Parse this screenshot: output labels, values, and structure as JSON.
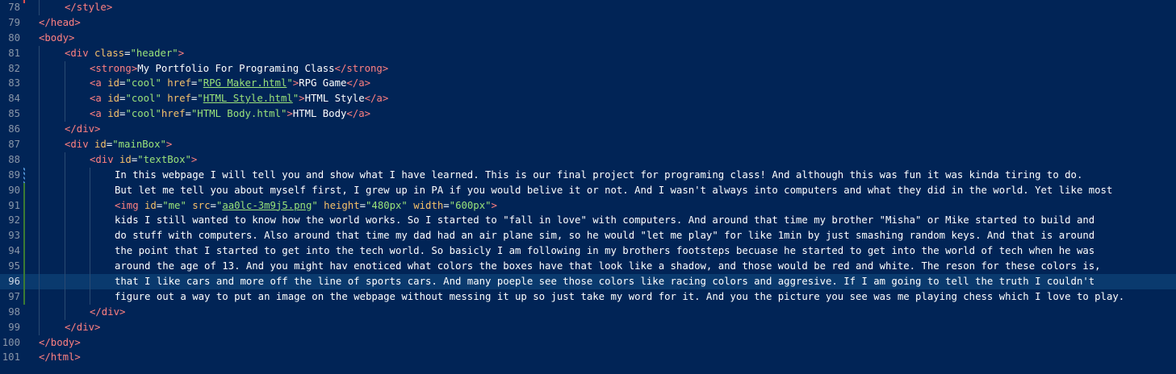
{
  "editor": {
    "line_numbers": [
      "78",
      "79",
      "80",
      "81",
      "82",
      "83",
      "84",
      "85",
      "86",
      "87",
      "88",
      "89",
      "90",
      "91",
      "92",
      "93",
      "94",
      "95",
      "96",
      "97",
      "98",
      "99",
      "100",
      "101"
    ],
    "l78": {
      "close_style": "</style>"
    },
    "l79": {
      "close_head": "</head>"
    },
    "l80": {
      "open_body": "<body>"
    },
    "l81": {
      "open": "<div ",
      "attr": "class",
      "eq": "=",
      "val": "\"header\"",
      "close": ">"
    },
    "l82": {
      "open": "<strong>",
      "text": "My Portfolio For Programing Class",
      "close": "</strong>"
    },
    "l83": {
      "open": "<a ",
      "attr1": "id",
      "eq1": "=",
      "val1": "\"cool\"",
      "attr2": " href",
      "eq2": "=",
      "q1": "\"",
      "href": "RPG Maker.html",
      "q2": "\"",
      "gt": ">",
      "text": "RPG Game",
      "close": "</a>"
    },
    "l84": {
      "open": "<a ",
      "attr1": "id",
      "eq1": "=",
      "val1": "\"cool\"",
      "attr2": " href",
      "eq2": "=",
      "q1": "\"",
      "href": "HTML Style.html",
      "q2": "\"",
      "gt": ">",
      "text": "HTML Style",
      "close": "</a>"
    },
    "l85": {
      "open": "<a ",
      "attr1": "id",
      "eq1": "=",
      "val1": "\"cool\"",
      "attr2": "href",
      "eq2": "=",
      "val2": "\"HTML Body.html\"",
      "gt": ">",
      "text": "HTML Body",
      "close": "</a>"
    },
    "l86": {
      "close_div": "</div>"
    },
    "l87": {
      "open": "<div ",
      "attr": "id",
      "eq": "=",
      "val": "\"mainBox\"",
      "close": ">"
    },
    "l88": {
      "open": "<div ",
      "attr": "id",
      "eq": "=",
      "val": "\"textBox\"",
      "close": ">"
    },
    "l89": "In this webpage I will tell you and show what I have learned. This is our final project for programing class! And although this was fun it was kinda tiring to do.",
    "l90": "But let me tell you about myself first, I grew up in PA if you would belive it or not. And I wasn't always into computers and what they did in the world. Yet like most",
    "l91": {
      "open": "<img ",
      "attr1": "id",
      "eq1": "=",
      "val1": "\"me\"",
      "attr2": " src",
      "eq2": "=",
      "q1": "\"",
      "src": "aa0lc-3m9j5.png",
      "q2": "\"",
      "attr3": " height",
      "eq3": "=",
      "val3": "\"480px\"",
      "attr4": " width",
      "eq4": "=",
      "val4": "\"600px\"",
      "close": ">"
    },
    "l92": "kids I still wanted to know how the world works. So I started to \"fall in love\" with computers. And around that time my brother \"Misha\" or Mike started to build and",
    "l93": "do stuff with computers. Also around that time my dad had an air plane sim, so he would \"let me play\" for like 1min by just smashing random keys. And that is around",
    "l94": "the point that I started to get into the tech world. So basicly I am following in my brothers footsteps becuase he started to get into the world of tech when he was",
    "l95": "around the age of 13. And you might hav enoticed what colors the boxes have that look like a shadow, and those would be red and white. The reson for these colors is,",
    "l96": "that I like cars and more off the line of sports cars. And many poeple see those colors like racing colors and aggresive. If I am going to tell the truth I couldn't",
    "l97": "figure out a way to put an image on the webpage without messing it up so just take my word for it. And you the picture you see was me playing chess which I love to play.",
    "l98": {
      "close_div": "</div>"
    },
    "l99": {
      "close_div": "</div>"
    },
    "l100": {
      "close_body": "</body>"
    },
    "l101": {
      "close_html": "</html>"
    }
  },
  "colors": {
    "background": "#012456",
    "tag": "#ff8080",
    "attribute": "#f5c06a",
    "string": "#9be37a",
    "text": "#ffffff",
    "line_number": "#8a96a8",
    "current_line": "#0a3a6e"
  }
}
